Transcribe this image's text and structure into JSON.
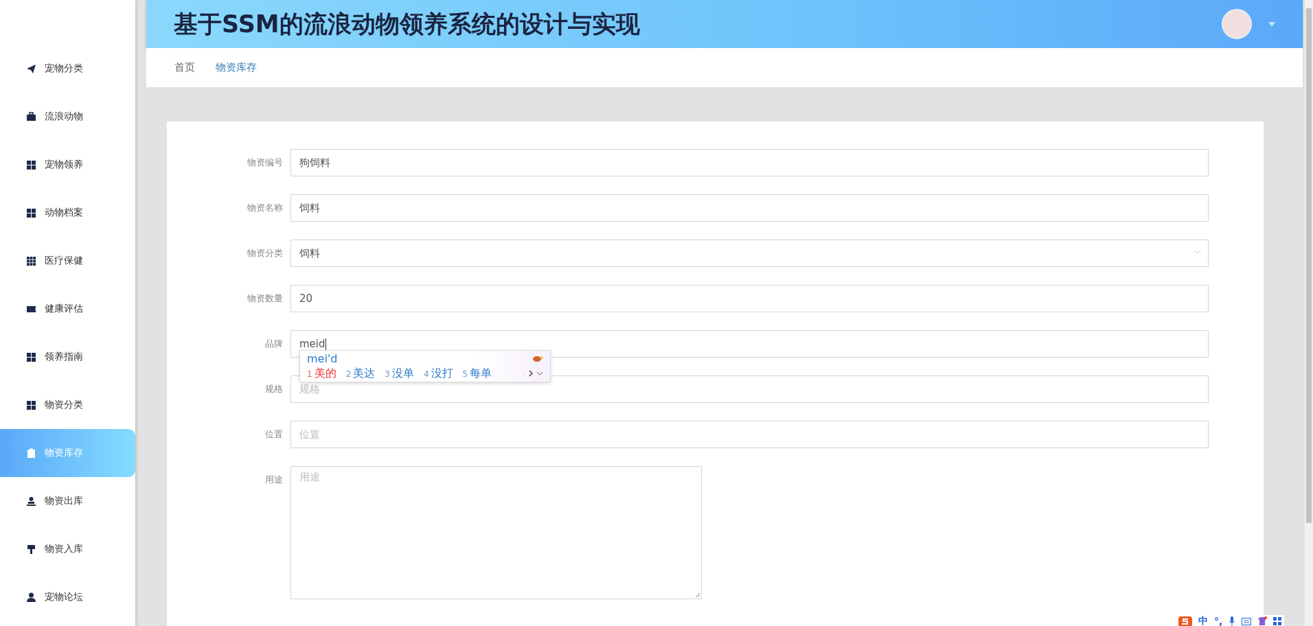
{
  "sidebar": {
    "items": [
      {
        "label": "宠物分类",
        "selected": false
      },
      {
        "label": "流浪动物",
        "selected": false
      },
      {
        "label": "宠物领养",
        "selected": false
      },
      {
        "label": "动物档案",
        "selected": false
      },
      {
        "label": "医疗保健",
        "selected": false
      },
      {
        "label": "健康评估",
        "selected": false
      },
      {
        "label": "领养指南",
        "selected": false
      },
      {
        "label": "物资分类",
        "selected": false
      },
      {
        "label": "物资库存",
        "selected": true
      },
      {
        "label": "物资出库",
        "selected": false
      },
      {
        "label": "物资入库",
        "selected": false
      },
      {
        "label": "宠物论坛",
        "selected": false
      }
    ]
  },
  "header": {
    "title": "基于SSM的流浪动物领养系统的设计与实现"
  },
  "breadcrumb": [
    {
      "label": "首页",
      "selected": false
    },
    {
      "label": "物资库存",
      "selected": true
    }
  ],
  "form": {
    "fields": [
      {
        "kind": "text",
        "label": "物资编号",
        "value": "狗饲料"
      },
      {
        "kind": "text",
        "label": "物资名称",
        "value": "饲料"
      },
      {
        "kind": "select",
        "label": "物资分类",
        "value": "饲料"
      },
      {
        "kind": "text",
        "label": "物资数量",
        "value": "20"
      },
      {
        "kind": "text",
        "label": "品牌",
        "value": "meid"
      },
      {
        "kind": "text",
        "label": "规格",
        "placeholder": "规格"
      },
      {
        "kind": "text",
        "label": "位置",
        "placeholder": "位置"
      },
      {
        "kind": "textarea",
        "label": "用途",
        "placeholder": "用途"
      }
    ]
  },
  "ime_popup": {
    "composition": "mei'd",
    "candidates": [
      {
        "number": "1",
        "text": "美的",
        "selected": true
      },
      {
        "number": "2",
        "text": "美达",
        "selected": false
      },
      {
        "number": "3",
        "text": "没单",
        "selected": false
      },
      {
        "number": "4",
        "text": "没打",
        "selected": false
      },
      {
        "number": "5",
        "text": "每单",
        "selected": false
      }
    ]
  },
  "ime_toolbar": {
    "mode": "中",
    "punctuation": "°,"
  }
}
